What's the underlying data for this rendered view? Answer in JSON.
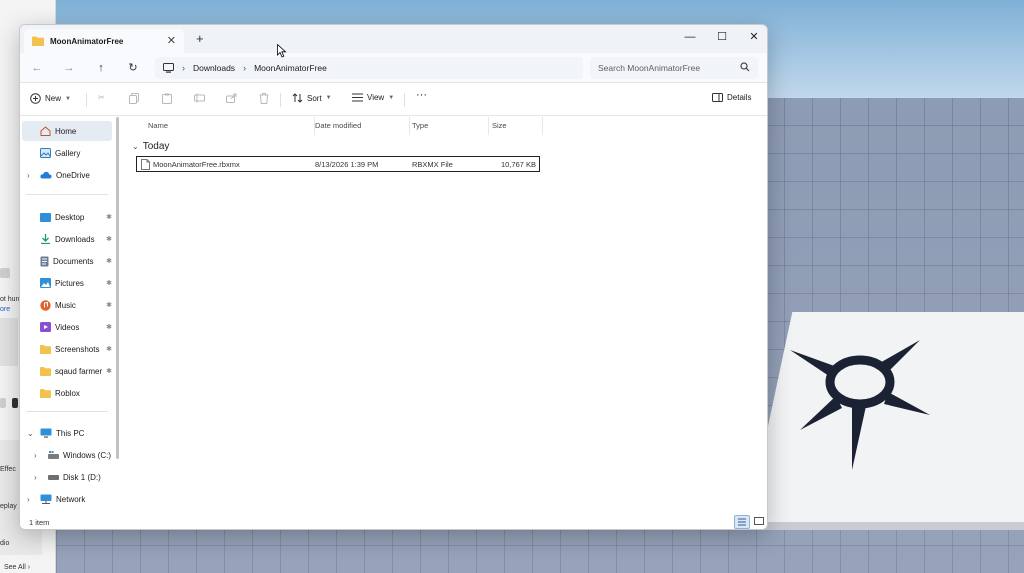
{
  "window": {
    "tab_title": "MoonAnimatorFree",
    "new_tab_glyph": "+",
    "tab_close_glyph": "✕",
    "minimize_glyph": "—",
    "maximize_glyph": "☐",
    "close_glyph": "✕"
  },
  "navigation": {
    "back_glyph": "←",
    "forward_glyph": "→",
    "up_glyph": "↑",
    "refresh_glyph": "↻",
    "breadcrumbs": [
      "Downloads",
      "MoonAnimatorFree"
    ],
    "crumb_separator": "›",
    "search_placeholder": "Search MoonAnimatorFree"
  },
  "toolbar": {
    "new_label": "New",
    "sort_label": "Sort",
    "view_label": "View",
    "more_glyph": "···",
    "details_label": "Details"
  },
  "sidebar": {
    "quick": [
      {
        "label": "Home",
        "icon": "home-icon",
        "selected": true
      },
      {
        "label": "Gallery",
        "icon": "gallery-icon"
      },
      {
        "label": "OneDrive",
        "icon": "onedrive-icon",
        "expandable": true
      }
    ],
    "pinned": [
      {
        "label": "Desktop",
        "icon": "desktop-icon",
        "pin": true
      },
      {
        "label": "Downloads",
        "icon": "downloads-icon",
        "pin": true
      },
      {
        "label": "Documents",
        "icon": "documents-icon",
        "pin": true
      },
      {
        "label": "Pictures",
        "icon": "pictures-icon",
        "pin": true
      },
      {
        "label": "Music",
        "icon": "music-icon",
        "pin": true
      },
      {
        "label": "Videos",
        "icon": "videos-icon",
        "pin": true
      },
      {
        "label": "Screenshots",
        "icon": "folder-icon",
        "pin": true
      },
      {
        "label": "sqaud farmer",
        "icon": "folder-icon",
        "pin": true
      },
      {
        "label": "Roblox",
        "icon": "folder-icon",
        "pin": false
      }
    ],
    "this_pc": {
      "label": "This PC",
      "icon": "this-pc-icon"
    },
    "drives": [
      {
        "label": "Windows (C:)",
        "icon": "windows-drive-icon"
      },
      {
        "label": "Disk 1 (D:)",
        "icon": "disk-drive-icon"
      }
    ],
    "network": {
      "label": "Network",
      "icon": "network-icon"
    },
    "pin_glyph": "📌"
  },
  "columns": [
    "Name",
    "Date modified",
    "Type",
    "Size"
  ],
  "groups": [
    {
      "title": "Today",
      "files": [
        {
          "name": "MoonAnimatorFree.rbxmx",
          "date": "8/13/2026 1:39 PM",
          "type": "RBXMX File",
          "size": "10,767 KB"
        }
      ]
    }
  ],
  "status": {
    "item_count": "1 item"
  },
  "left_app_fragments": {
    "frag1": "ot hun",
    "frag2": "ore",
    "frag3": "Effec",
    "frag4": "eplay",
    "frag5": "dio",
    "see_all": "See All ›"
  },
  "colors": {
    "accent": "#0067c0",
    "folder": "#f2c14e",
    "selection": "#e5ebf3"
  }
}
